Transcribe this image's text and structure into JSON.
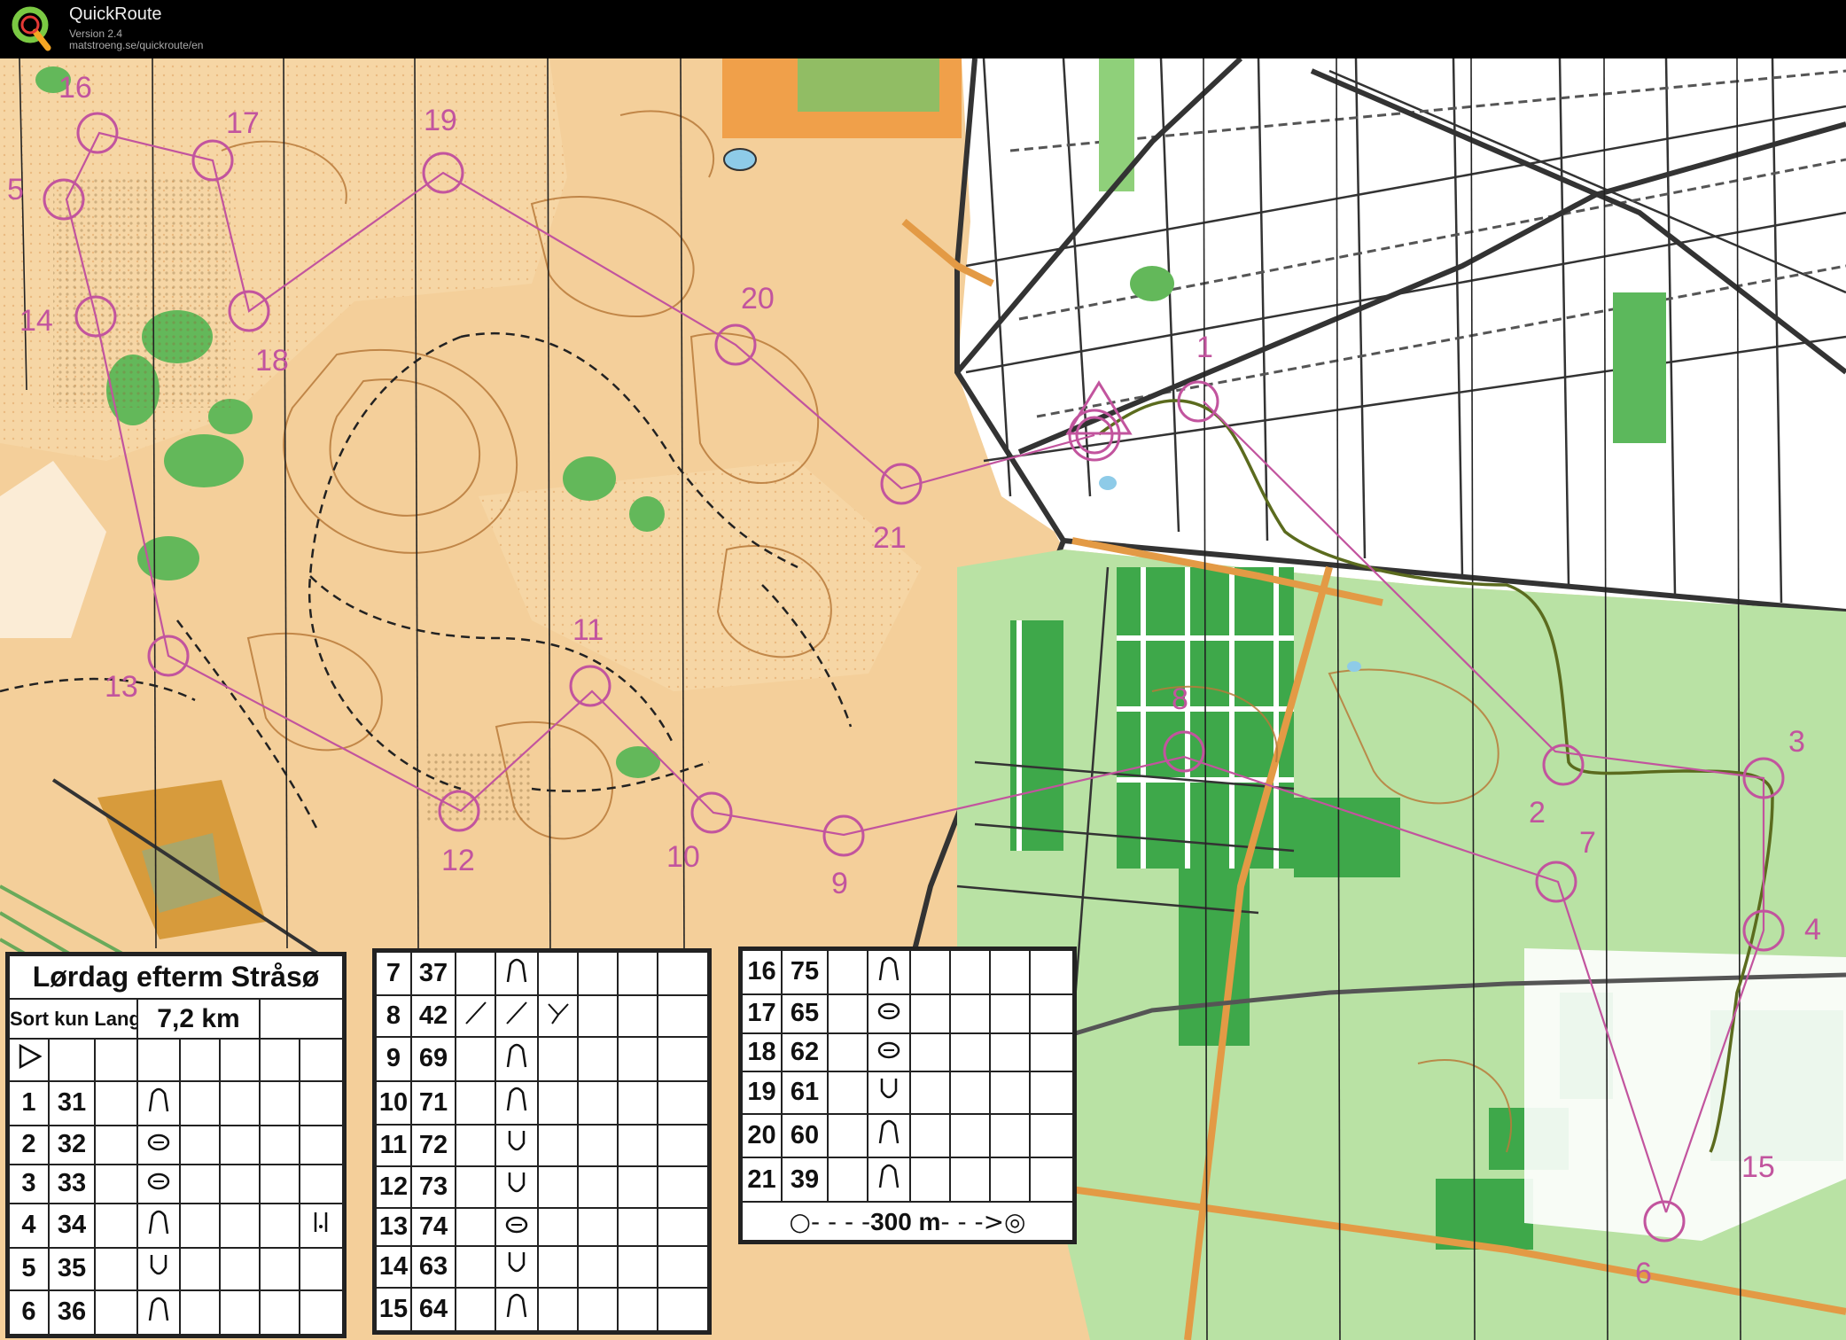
{
  "app": {
    "title": "QuickRoute",
    "version": "Version 2.4",
    "url": "matstroeng.se/quickroute/en"
  },
  "colors": {
    "course": "#c2549e",
    "route": "#5b6b1e",
    "open_land": "#f2c890",
    "forest_green": "#59b454",
    "light_green": "#a7d98e",
    "white_forest": "#ffffff",
    "tracks": "#222222",
    "orange_roads": "#e39a45"
  },
  "controls": [
    {
      "number": "1"
    },
    {
      "number": "2"
    },
    {
      "number": "3"
    },
    {
      "number": "4"
    },
    {
      "number": "5"
    },
    {
      "number": "6"
    },
    {
      "number": "7"
    },
    {
      "number": "8"
    },
    {
      "number": "9"
    },
    {
      "number": "10"
    },
    {
      "number": "11"
    },
    {
      "number": "12"
    },
    {
      "number": "13"
    },
    {
      "number": "14"
    },
    {
      "number": "15"
    },
    {
      "number": "16"
    },
    {
      "number": "17"
    },
    {
      "number": "18"
    },
    {
      "number": "19"
    },
    {
      "number": "20"
    },
    {
      "number": "21"
    }
  ],
  "course": {
    "title": "Lørdag efterm Stråsø",
    "class": "Sort kun Lang",
    "length": "7,2 km",
    "finish_note": "300 m",
    "rows": [
      {
        "n": "1",
        "code": "31",
        "sym": "hill"
      },
      {
        "n": "2",
        "code": "32",
        "sym": "knoll"
      },
      {
        "n": "3",
        "code": "33",
        "sym": "knoll"
      },
      {
        "n": "4",
        "code": "34",
        "sym": "hill",
        "extra": "post"
      },
      {
        "n": "5",
        "code": "35",
        "sym": "depression"
      },
      {
        "n": "6",
        "code": "36",
        "sym": "hill"
      },
      {
        "n": "7",
        "code": "37",
        "sym": "hill"
      },
      {
        "n": "8",
        "code": "42",
        "sym": "crossing"
      },
      {
        "n": "9",
        "code": "69",
        "sym": "hill"
      },
      {
        "n": "10",
        "code": "71",
        "sym": "hill"
      },
      {
        "n": "11",
        "code": "72",
        "sym": "depression"
      },
      {
        "n": "12",
        "code": "73",
        "sym": "depression"
      },
      {
        "n": "13",
        "code": "74",
        "sym": "knoll"
      },
      {
        "n": "14",
        "code": "63",
        "sym": "depression"
      },
      {
        "n": "15",
        "code": "64",
        "sym": "hill"
      },
      {
        "n": "16",
        "code": "75",
        "sym": "hill"
      },
      {
        "n": "17",
        "code": "65",
        "sym": "knoll"
      },
      {
        "n": "18",
        "code": "62",
        "sym": "knoll"
      },
      {
        "n": "19",
        "code": "61",
        "sym": "depression"
      },
      {
        "n": "20",
        "code": "60",
        "sym": "hill"
      },
      {
        "n": "21",
        "code": "39",
        "sym": "hill"
      }
    ]
  }
}
